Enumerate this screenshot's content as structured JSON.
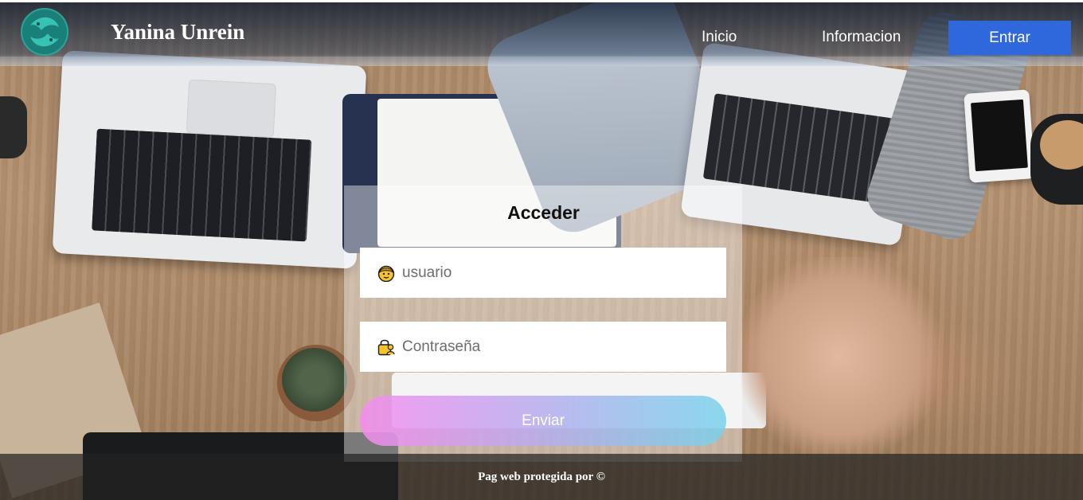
{
  "header": {
    "brand": "Yanina Unrein",
    "nav": {
      "inicio": "Inicio",
      "informacion": "Informacion",
      "entrar": "Entrar"
    },
    "logo_icon": "pisces-fish-logo",
    "colors": {
      "entrar_button": "#2f68dc",
      "logo": "#1f8f88"
    }
  },
  "login": {
    "title": "Acceder",
    "username": {
      "placeholder": "usuario",
      "icon": "user-face-icon"
    },
    "password": {
      "placeholder": "Contraseña",
      "icon": "lock-user-icon"
    },
    "submit_label": "Enviar",
    "colors": {
      "submit_gradient": [
        "#f68cf0",
        "#78d2ec"
      ]
    }
  },
  "footer": {
    "text": "Pag web protegida por ©"
  }
}
